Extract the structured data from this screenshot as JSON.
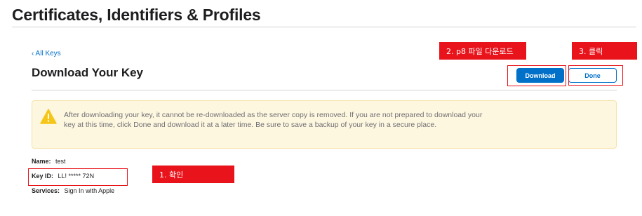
{
  "header": {
    "title": "Certificates, Identifiers & Profiles"
  },
  "nav": {
    "back_link": "‹ All Keys"
  },
  "section": {
    "title": "Download Your Key",
    "download_button": "Download",
    "done_button": "Done"
  },
  "warning": {
    "icon": "warning-triangle-icon",
    "text": "After downloading your key, it cannot be re-downloaded as the server copy is removed. If you are not prepared to download your key at this time, click Done and download it at a later time. Be sure to save a backup of your key in a secure place."
  },
  "key_details": {
    "name_label": "Name:",
    "name_value": "test",
    "key_id_label": "Key ID:",
    "key_id_value": "LL! ***** 72N",
    "services_label": "Services:",
    "services_value": "Sign In with Apple"
  },
  "annotations": {
    "step1": "1. 확인",
    "step2": "2. p8 파일 다운로드",
    "step3": "3. 클릭",
    "color": "#e8131b"
  },
  "colors": {
    "accent": "#0070c9",
    "warning_bg": "#fef7e0",
    "warning_icon": "#f5c518"
  }
}
